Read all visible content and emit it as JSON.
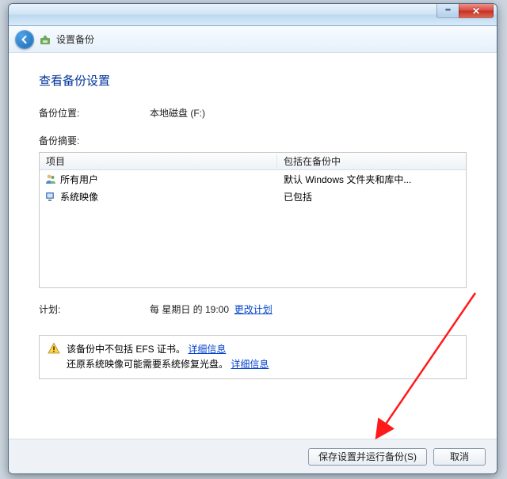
{
  "nav": {
    "title": "设置备份"
  },
  "page": {
    "heading": "查看备份设置",
    "location_label": "备份位置:",
    "location_value": "本地磁盘 (F:)",
    "summary_label": "备份摘要:"
  },
  "table": {
    "col1": "项目",
    "col2": "包括在备份中",
    "rows": [
      {
        "icon": "users-icon",
        "name": "所有用户",
        "included": "默认 Windows 文件夹和库中..."
      },
      {
        "icon": "system-image-icon",
        "name": "系统映像",
        "included": "已包括"
      }
    ]
  },
  "schedule": {
    "label": "计划:",
    "value": "每 星期日 的 19:00",
    "change_link": "更改计划"
  },
  "warning": {
    "line1_prefix": "该备份中不包括 EFS 证书。",
    "details_link": "详细信息",
    "line2_prefix": "还原系统映像可能需要系统修复光盘。"
  },
  "buttons": {
    "save_run": "保存设置并运行备份(S)",
    "cancel": "取消"
  }
}
